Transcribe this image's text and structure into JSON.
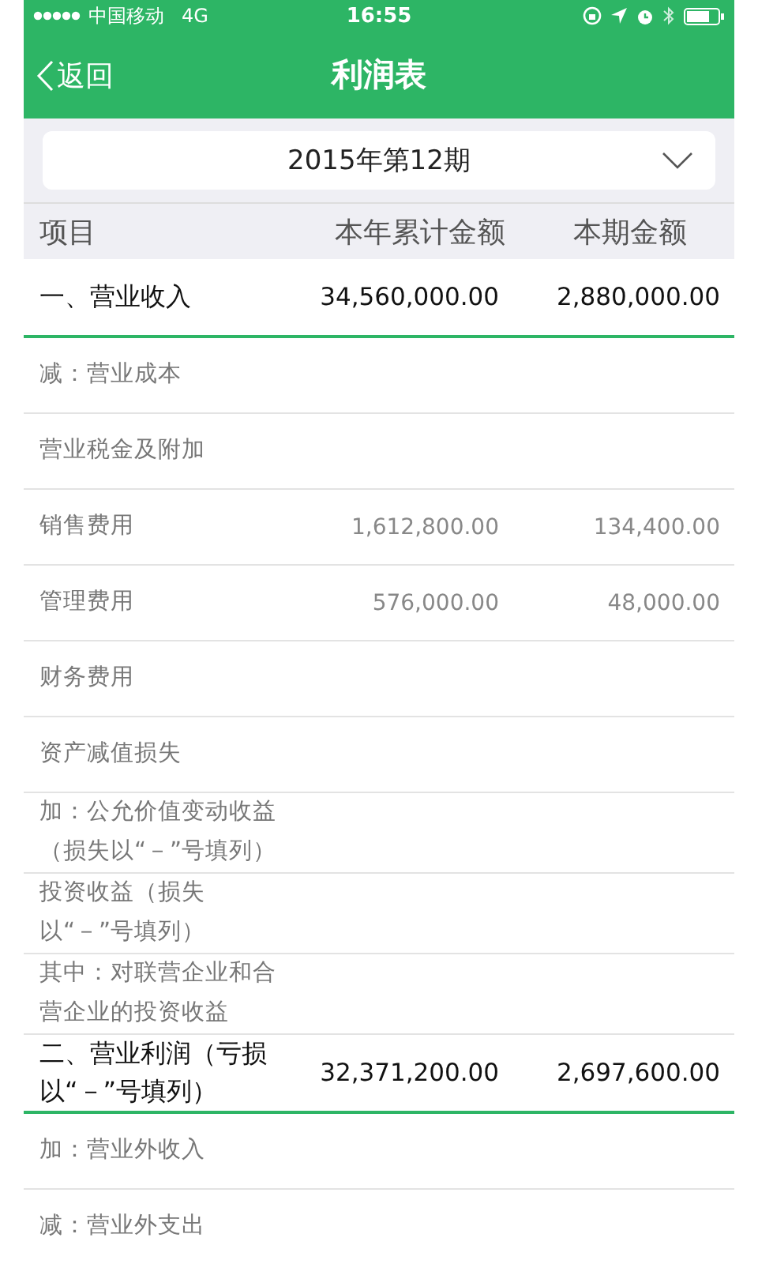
{
  "status_bar": {
    "carrier": "中国移动",
    "network": "4G",
    "time": "16:55"
  },
  "nav": {
    "back": "返回",
    "title": "利润表"
  },
  "period_picker": {
    "value": "2015年第12期"
  },
  "table": {
    "columns": [
      "项目",
      "本年累计金额",
      "本期金额"
    ],
    "rows": [
      {
        "kind": "total",
        "label": [
          "一、营业收入"
        ],
        "year": "34,560,000.00",
        "period": "2,880,000.00"
      },
      {
        "kind": "item",
        "label": [
          "减：营业成本"
        ]
      },
      {
        "kind": "item",
        "label": [
          "营业税金及附加"
        ]
      },
      {
        "kind": "item",
        "label": [
          "销售费用"
        ],
        "year": "1,612,800.00",
        "period": "134,400.00"
      },
      {
        "kind": "item",
        "label": [
          "管理费用"
        ],
        "year": "576,000.00",
        "period": "48,000.00"
      },
      {
        "kind": "item",
        "label": [
          "财务费用"
        ]
      },
      {
        "kind": "item",
        "label": [
          "资产减值损失"
        ]
      },
      {
        "kind": "item",
        "label": [
          "加：公允价值变动收益",
          "（损失以“－”号填列）"
        ]
      },
      {
        "kind": "item",
        "label": [
          "投资收益（损失",
          "以“－”号填列）"
        ]
      },
      {
        "kind": "item",
        "label": [
          "其中：对联营企业和合",
          "营企业的投资收益"
        ]
      },
      {
        "kind": "total",
        "label": [
          "二、营业利润（亏损",
          "以“－”号填列）"
        ],
        "year": "32,371,200.00",
        "period": "2,697,600.00"
      },
      {
        "kind": "item",
        "label": [
          "加：营业外收入"
        ]
      },
      {
        "kind": "item",
        "label": [
          "减：营业外支出"
        ]
      }
    ]
  }
}
